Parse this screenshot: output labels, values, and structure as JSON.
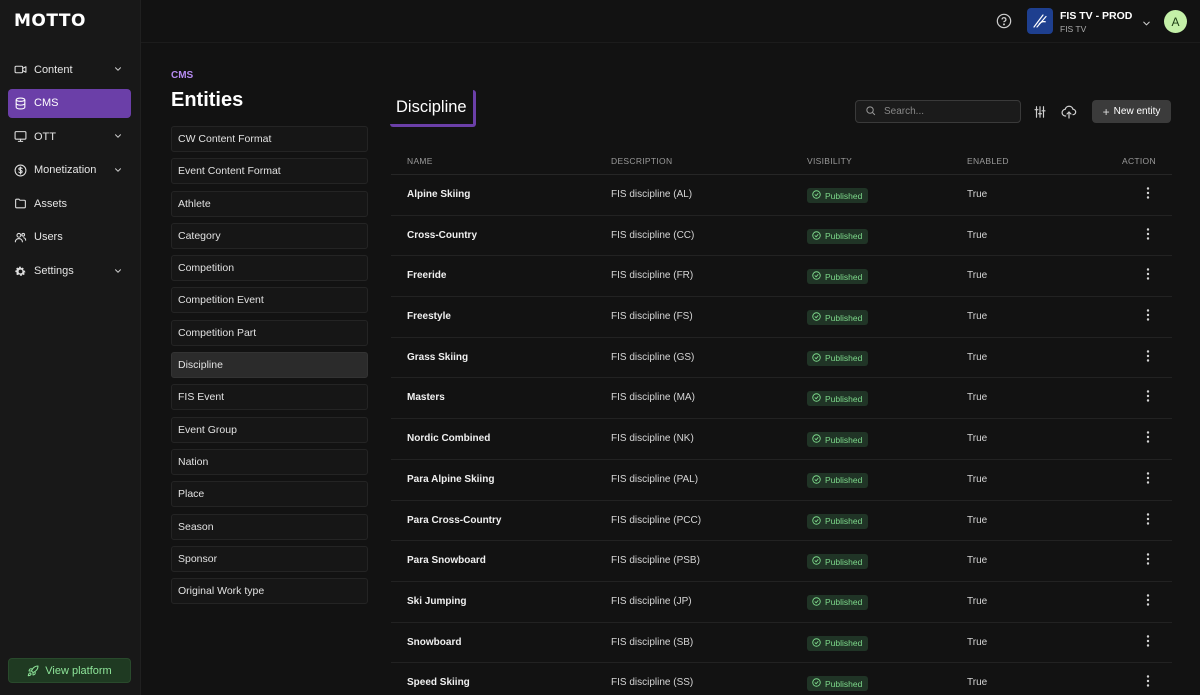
{
  "app": {
    "logo": "MOTTO"
  },
  "sidebar": {
    "items": [
      {
        "label": "Content",
        "icon": "video-icon",
        "expandable": true
      },
      {
        "label": "CMS",
        "icon": "database-icon",
        "expandable": false,
        "active": true
      },
      {
        "label": "OTT",
        "icon": "monitor-icon",
        "expandable": true
      },
      {
        "label": "Monetization",
        "icon": "dollar-icon",
        "expandable": true
      },
      {
        "label": "Assets",
        "icon": "folder-icon",
        "expandable": false
      },
      {
        "label": "Users",
        "icon": "users-icon",
        "expandable": false
      },
      {
        "label": "Settings",
        "icon": "gear-icon",
        "expandable": true
      }
    ],
    "view_platform": "View platform"
  },
  "topbar": {
    "org_name": "FIS TV - PROD",
    "org_sub": "FIS TV",
    "avatar_initial": "A"
  },
  "breadcrumb": "CMS",
  "page_title": "Entities",
  "entities": [
    "CW Content Format",
    "Event Content Format",
    "Athlete",
    "Category",
    "Competition",
    "Competition Event",
    "Competition Part",
    "Discipline",
    "FIS Event",
    "Event Group",
    "Nation",
    "Place",
    "Season",
    "Sponsor",
    "Original Work type"
  ],
  "selected_entity": "Discipline",
  "main": {
    "title": "Discipline",
    "search_placeholder": "Search...",
    "new_entity_label": "New entity"
  },
  "table": {
    "headers": {
      "name": "NAME",
      "description": "DESCRIPTION",
      "visibility": "VISIBILITY",
      "enabled": "ENABLED",
      "action": "ACTION"
    },
    "rows": [
      {
        "name": "Alpine Skiing",
        "description": "FIS discipline (AL)",
        "visibility": "Published",
        "enabled": "True"
      },
      {
        "name": "Cross-Country",
        "description": "FIS discipline (CC)",
        "visibility": "Published",
        "enabled": "True"
      },
      {
        "name": "Freeride",
        "description": "FIS discipline (FR)",
        "visibility": "Published",
        "enabled": "True"
      },
      {
        "name": "Freestyle",
        "description": "FIS discipline (FS)",
        "visibility": "Published",
        "enabled": "True"
      },
      {
        "name": "Grass Skiing",
        "description": "FIS discipline (GS)",
        "visibility": "Published",
        "enabled": "True"
      },
      {
        "name": "Masters",
        "description": "FIS discipline (MA)",
        "visibility": "Published",
        "enabled": "True"
      },
      {
        "name": "Nordic Combined",
        "description": "FIS discipline (NK)",
        "visibility": "Published",
        "enabled": "True"
      },
      {
        "name": "Para Alpine Skiing",
        "description": "FIS discipline (PAL)",
        "visibility": "Published",
        "enabled": "True"
      },
      {
        "name": "Para Cross-Country",
        "description": "FIS discipline (PCC)",
        "visibility": "Published",
        "enabled": "True"
      },
      {
        "name": "Para Snowboard",
        "description": "FIS discipline (PSB)",
        "visibility": "Published",
        "enabled": "True"
      },
      {
        "name": "Ski Jumping",
        "description": "FIS discipline (JP)",
        "visibility": "Published",
        "enabled": "True"
      },
      {
        "name": "Snowboard",
        "description": "FIS discipline (SB)",
        "visibility": "Published",
        "enabled": "True"
      },
      {
        "name": "Speed Skiing",
        "description": "FIS discipline (SS)",
        "visibility": "Published",
        "enabled": "True"
      }
    ]
  },
  "colors": {
    "accent": "#6b3fa8",
    "published": "#7dd98b",
    "view_platform": "#8ee59a"
  }
}
